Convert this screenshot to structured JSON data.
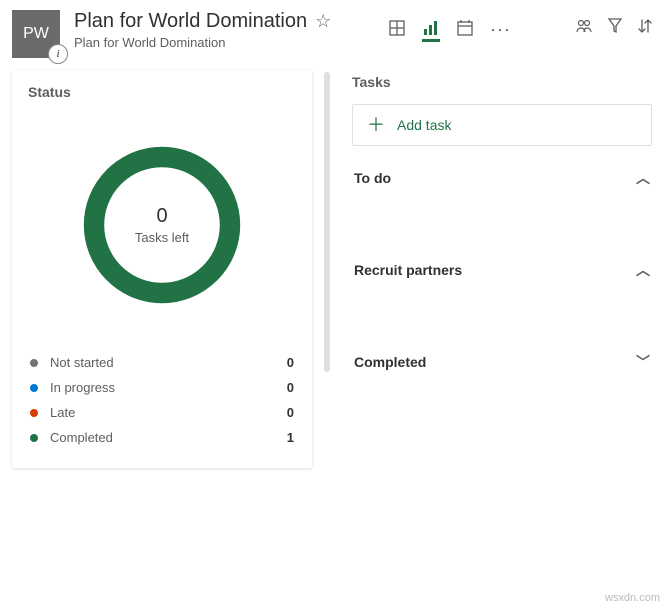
{
  "header": {
    "tile_initials": "PW",
    "title": "Plan for World Domination",
    "subtitle": "Plan for World Domination"
  },
  "views": {
    "board": "Board",
    "charts": "Charts",
    "schedule": "Schedule"
  },
  "status_card": {
    "title": "Status",
    "center_value": "0",
    "center_label": "Tasks left",
    "legend": [
      {
        "label": "Not started",
        "count": "0",
        "color": "#737373"
      },
      {
        "label": "In progress",
        "count": "0",
        "color": "#0078d4"
      },
      {
        "label": "Late",
        "count": "0",
        "color": "#d83b01"
      },
      {
        "label": "Completed",
        "count": "1",
        "color": "#217346"
      }
    ]
  },
  "tasks_pane": {
    "title": "Tasks",
    "add_label": "Add task",
    "buckets": [
      {
        "name": "To do",
        "collapsed": true
      },
      {
        "name": "Recruit partners",
        "collapsed": true
      },
      {
        "name": "Completed",
        "collapsed": false
      }
    ]
  },
  "chart_data": {
    "type": "pie",
    "title": "Status",
    "categories": [
      "Not started",
      "In progress",
      "Late",
      "Completed"
    ],
    "values": [
      0,
      0,
      0,
      1
    ],
    "colors": [
      "#737373",
      "#0078d4",
      "#d83b01",
      "#217346"
    ],
    "center_annotation": "0 Tasks left"
  },
  "watermark": "wsxdn.com"
}
